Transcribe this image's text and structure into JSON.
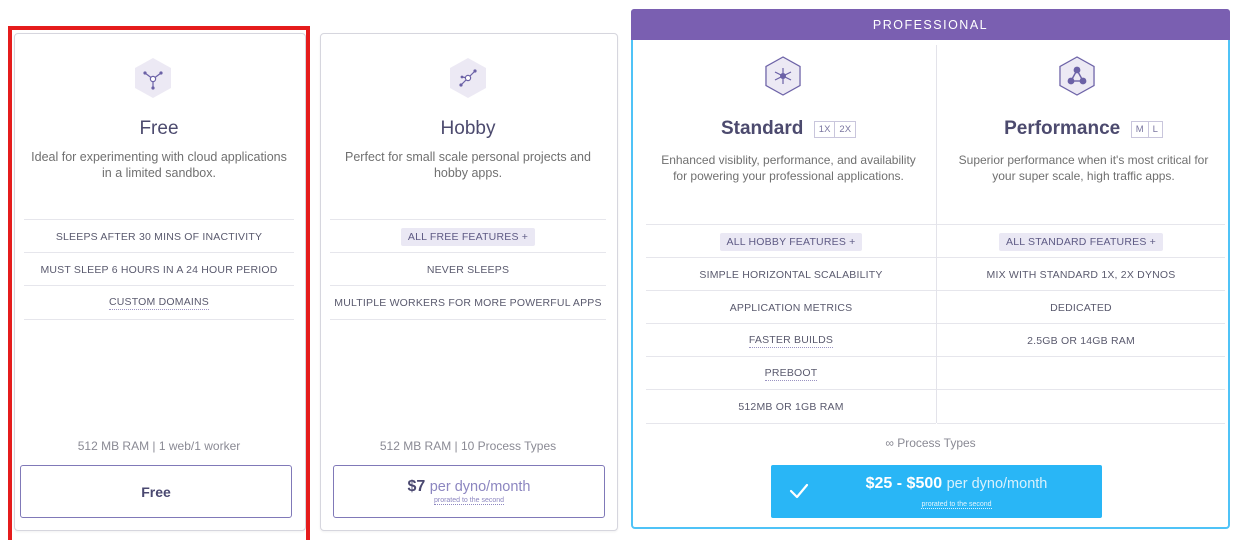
{
  "free": {
    "title": "Free",
    "desc_line1": "Ideal for experimenting with cloud applications",
    "desc_line2": "in a limited sandbox.",
    "features": [
      "SLEEPS AFTER 30 MINS OF INACTIVITY",
      "MUST SLEEP 6 HOURS IN A 24 HOUR PERIOD",
      "CUSTOM DOMAINS"
    ],
    "spec": "512 MB RAM | 1 web/1 worker",
    "button_label": "Free"
  },
  "hobby": {
    "title": "Hobby",
    "desc_line1": "Perfect for small scale personal projects and",
    "desc_line2": "hobby apps.",
    "features": [
      "ALL FREE FEATURES +",
      "NEVER SLEEPS",
      "MULTIPLE WORKERS FOR MORE POWERFUL APPS"
    ],
    "spec": "512 MB RAM | 10 Process Types",
    "price": "$7",
    "price_unit": "per dyno/month",
    "prorated": "prorated to the second"
  },
  "professional": {
    "header": "PROFESSIONAL",
    "process_types": "∞ Process Types",
    "price": "$25 - $500",
    "price_unit": "per dyno/month",
    "prorated": "prorated to the second",
    "check_icon": "check-icon",
    "standard": {
      "title": "Standard",
      "sizes": [
        "1X",
        "2X"
      ],
      "desc_line1": "Enhanced visiblity, performance, and availability",
      "desc_line2": "for powering your professional applications.",
      "features": [
        "ALL HOBBY FEATURES +",
        "SIMPLE HORIZONTAL SCALABILITY",
        "APPLICATION METRICS",
        "FASTER BUILDS",
        "PREBOOT",
        "512MB OR 1GB RAM"
      ]
    },
    "performance": {
      "title": "Performance",
      "sizes": [
        "M",
        "L"
      ],
      "desc_line1": "Superior performance when it's most critical for",
      "desc_line2": "your super scale, high traffic apps.",
      "features": [
        "ALL STANDARD FEATURES +",
        "MIX WITH STANDARD 1X, 2X DYNOS",
        "DEDICATED",
        "2.5GB OR 14GB RAM"
      ]
    }
  },
  "colors": {
    "accent_purple": "#7a5fb1",
    "button_blue": "#29b6f6",
    "highlight_red": "#e51c1c",
    "professional_border": "#4fc3f7"
  }
}
